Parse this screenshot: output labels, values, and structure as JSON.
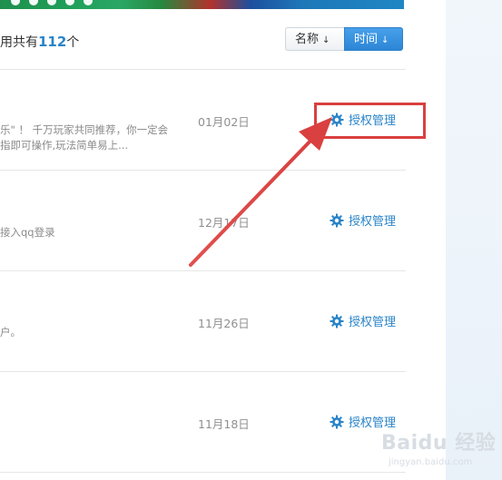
{
  "header": {
    "count_prefix": "用共有",
    "count_value": "112",
    "count_suffix": "个",
    "sort_name_label": "名称",
    "sort_time_label": "时间",
    "sort_arrow": "↓"
  },
  "apps": [
    {
      "desc_line1": "乐\" ！ 千万玩家共同推荐，你一定会",
      "desc_line2": "指即可操作,玩法简单易上...",
      "date": "01月02日",
      "action": "授权管理"
    },
    {
      "desc_line1": "接入qq登录",
      "desc_line2": "",
      "date": "12月17日",
      "action": "授权管理"
    },
    {
      "desc_line1": "户。",
      "desc_line2": "",
      "date": "11月26日",
      "action": "授权管理"
    },
    {
      "desc_line1": "",
      "desc_line2": "",
      "date": "11月18日",
      "action": "授权管理"
    }
  ],
  "watermark": {
    "logo": "Baidu 经验",
    "url": "jingyan.baidu.com"
  },
  "colors": {
    "accent": "#2a84c8",
    "annotation": "#d9403f"
  },
  "icons": {
    "auth": "gear-icon",
    "sort": "arrow-down-icon"
  }
}
